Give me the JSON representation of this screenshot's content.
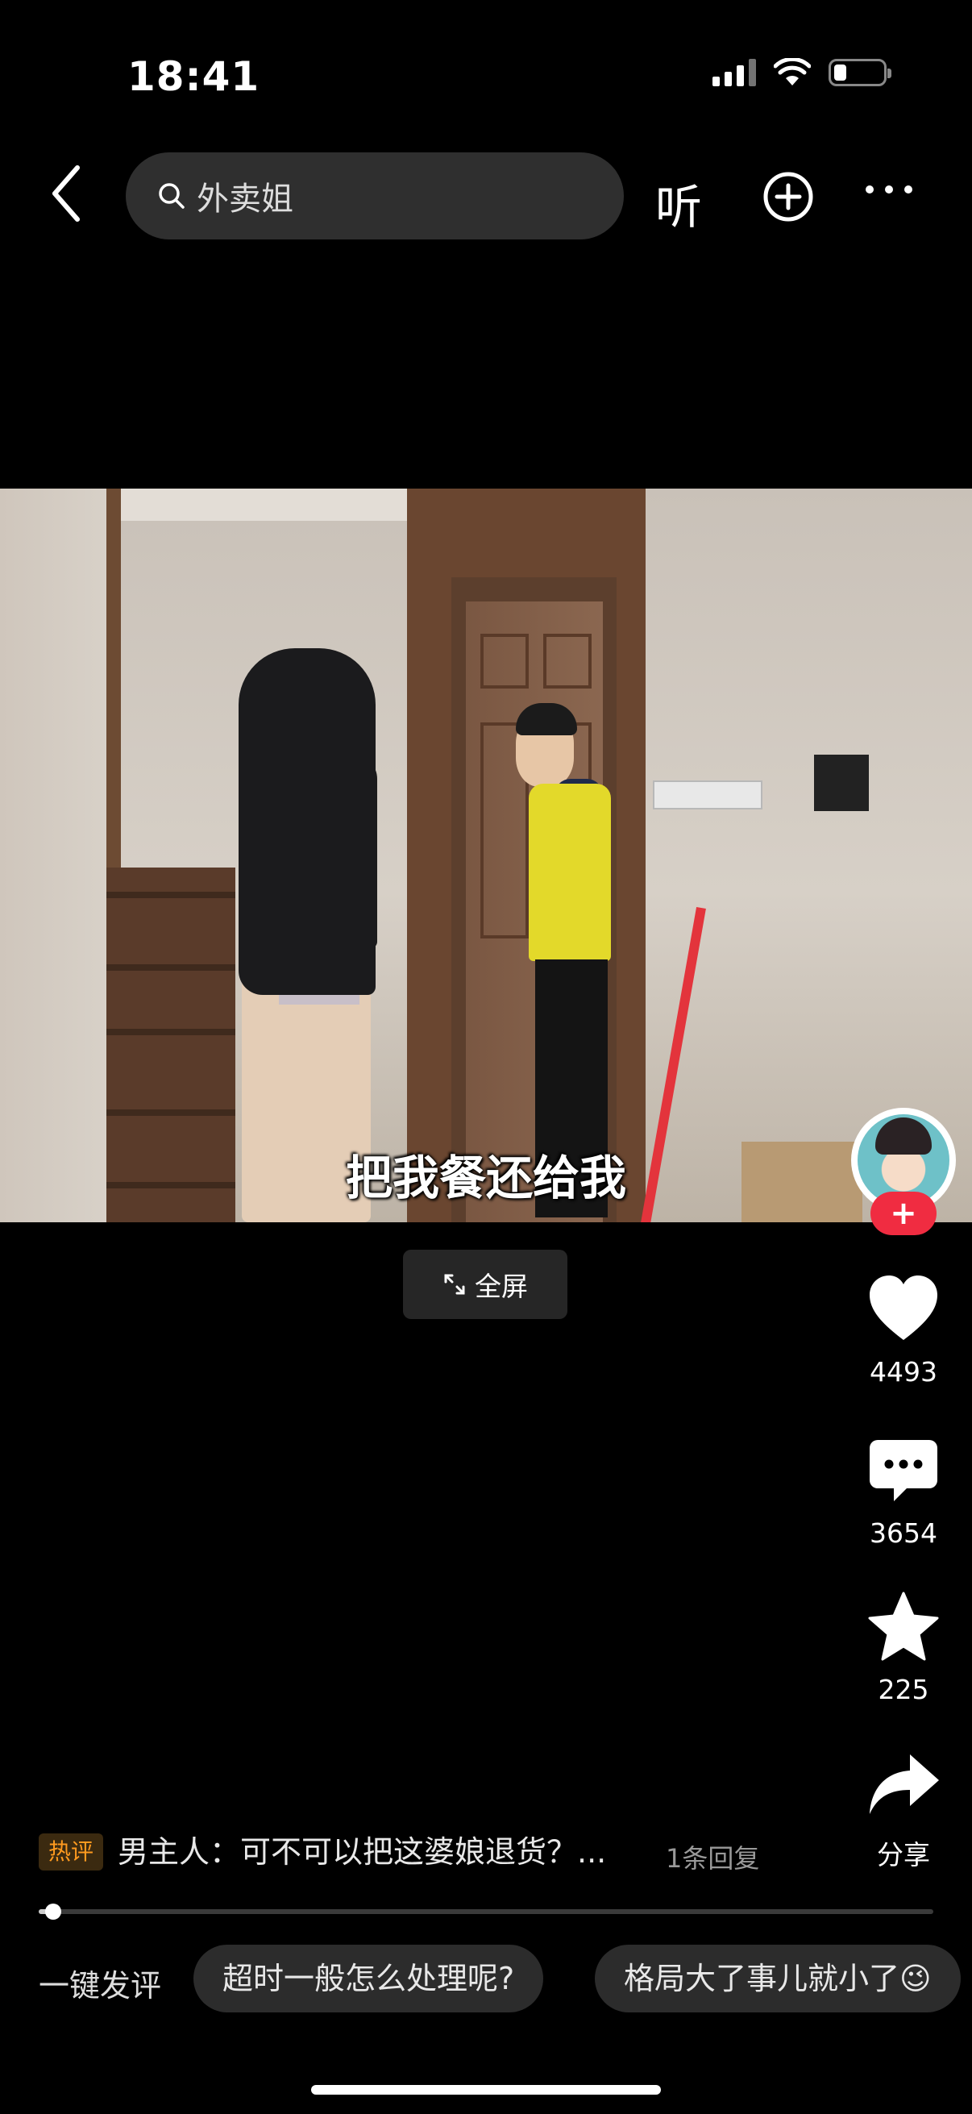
{
  "status_bar": {
    "time": "18:41",
    "battery_percent": 25
  },
  "top_nav": {
    "search_text": "外卖姐",
    "listen_label": "听"
  },
  "video": {
    "subtitle": "把我餐还给我",
    "fullscreen_label": "全屏",
    "progress_fraction": 0.016
  },
  "actions": {
    "like_count": "4493",
    "comment_count": "3654",
    "collect_count": "225",
    "share_label": "分享",
    "follow_symbol": "+"
  },
  "hot_comment": {
    "tag": "热评",
    "text": "男主人：可不可以把这婆娘退货？...",
    "reply_count": "1条回复"
  },
  "quick_comments": {
    "label": "一键发评",
    "chips": [
      "超时一般怎么处理呢?",
      "格局大了事儿就小了😉"
    ]
  },
  "colors": {
    "accent_red": "#f02c41",
    "hot_tag_orange": "#ff9a1f",
    "vest_yellow": "#e3d92a"
  }
}
